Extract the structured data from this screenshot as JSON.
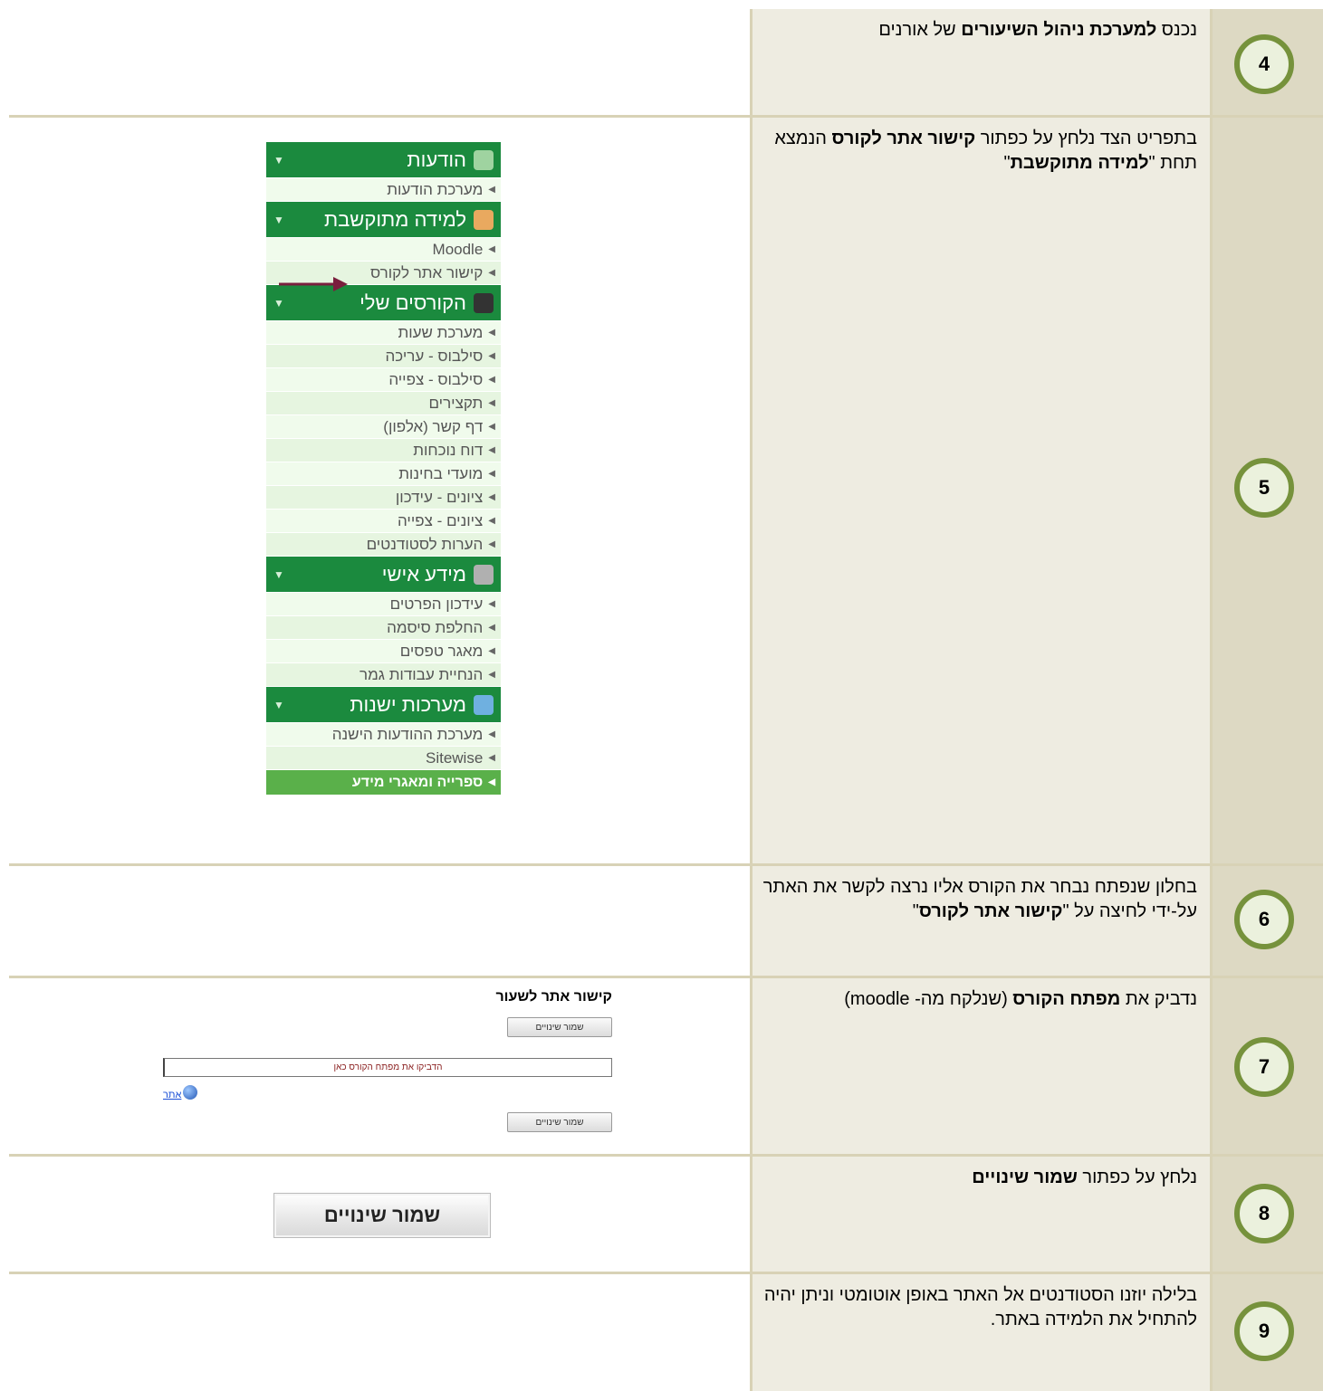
{
  "steps": [
    {
      "num": "4",
      "parts": [
        [
          "נכנס ",
          false
        ],
        [
          "למערכת ניהול השיעורים",
          true
        ],
        [
          " של אורנים",
          false
        ]
      ]
    },
    {
      "num": "5",
      "parts": [
        [
          "בתפריט הצד נלחץ על כפתור ",
          false
        ],
        [
          "קישור אתר לקורס",
          true
        ],
        [
          " הנמצא תחת \"",
          false
        ],
        [
          "למידה מתוקשבת",
          true
        ],
        [
          "\"",
          false
        ]
      ]
    },
    {
      "num": "6",
      "parts": [
        [
          "בחלון שנפתח נבחר את הקורס אליו נרצה לקשר את האתר על-ידי לחיצה על \"",
          false
        ],
        [
          "קישור אתר לקורס",
          true
        ],
        [
          "\"",
          false
        ]
      ]
    },
    {
      "num": "7",
      "parts": [
        [
          "נדביק את ",
          false
        ],
        [
          "מפתח הקורס",
          true
        ],
        [
          " (שנלקח מה- moodle)",
          false
        ]
      ]
    },
    {
      "num": "8",
      "parts": [
        [
          "נלחץ על כפתור ",
          false
        ],
        [
          "שמור שינויים",
          true
        ]
      ]
    },
    {
      "num": "9",
      "parts": [
        [
          "בלילה יוזנו הסטודנטים אל האתר באופן אוטומטי וניתן יהיה להתחיל את הלמידה באתר.",
          false
        ]
      ]
    }
  ],
  "menu": [
    {
      "type": "header",
      "label": "הודעות",
      "icon": "envelope-icon",
      "color": "#9fd3a0"
    },
    {
      "type": "item",
      "label": "מערכת הודעות"
    },
    {
      "type": "header",
      "label": "למידה מתוקשבת",
      "icon": "user-computer-icon",
      "color": "#e9a95f"
    },
    {
      "type": "item",
      "label": "Moodle"
    },
    {
      "type": "item",
      "label": "קישור אתר לקורס",
      "arrow": true
    },
    {
      "type": "header",
      "label": "הקורסים שלי",
      "icon": "clock-icon",
      "color": "#333333"
    },
    {
      "type": "item",
      "label": "מערכת שעות"
    },
    {
      "type": "item",
      "label": "סילבוס - עריכה"
    },
    {
      "type": "item",
      "label": "סילבוס - צפייה"
    },
    {
      "type": "item",
      "label": "תקצירים"
    },
    {
      "type": "item",
      "label": "דף קשר (אלפון)"
    },
    {
      "type": "item",
      "label": "דוח נוכחות"
    },
    {
      "type": "item",
      "label": "מועדי בחינות"
    },
    {
      "type": "item",
      "label": "ציונים - עידכון"
    },
    {
      "type": "item",
      "label": "ציונים - צפייה"
    },
    {
      "type": "item",
      "label": "הערות לסטודנטים"
    },
    {
      "type": "header",
      "label": "מידע אישי",
      "icon": "gear-icon",
      "color": "#b0b0b0"
    },
    {
      "type": "item",
      "label": "עידכון הפרטים"
    },
    {
      "type": "item",
      "label": "החלפת סיסמה"
    },
    {
      "type": "item",
      "label": "מאגר טפסים"
    },
    {
      "type": "item",
      "label": "הנחיית עבודות גמר"
    },
    {
      "type": "header",
      "label": "מערכות ישנות",
      "icon": "monitor-icon",
      "color": "#6fb0e0"
    },
    {
      "type": "item",
      "label": "מערכת ההודעות הישנה"
    },
    {
      "type": "item",
      "label": "Sitewise"
    },
    {
      "type": "last",
      "label": "ספרייה ומאגרי מידע"
    }
  ],
  "link_form": {
    "title": "קישור אתר לשעור",
    "save_label": "שמור שינויים",
    "input_placeholder": "הדביקו את מפתח הקורס כאן",
    "site_link": "אתר"
  },
  "save_button_big": "שמור שינויים",
  "colors": {
    "header_green": "#1b8a3e",
    "circle_border": "#76923c",
    "arrow": "#7a1f3d"
  }
}
